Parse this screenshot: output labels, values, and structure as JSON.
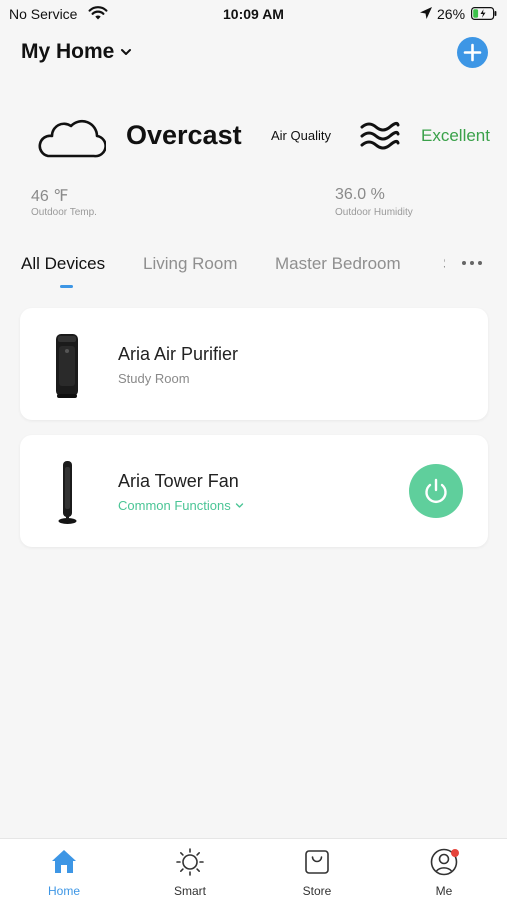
{
  "status_bar": {
    "carrier": "No Service",
    "time": "10:09 AM",
    "battery_percent": "26%",
    "battery_level": 0.26
  },
  "header": {
    "home_name": "My Home",
    "add_icon": "plus-icon"
  },
  "weather": {
    "condition": "Overcast",
    "condition_icon": "cloud-icon",
    "air_quality_label": "Air Quality",
    "air_quality_icon": "air-waves-icon",
    "air_quality_value": "Excellent",
    "air_quality_color": "#3aa14a",
    "temperature": {
      "value": "46 ℉",
      "label": "Outdoor Temp."
    },
    "humidity": {
      "value": "36.0 %",
      "label": "Outdoor Humidity"
    }
  },
  "tabs": [
    {
      "label": "All Devices",
      "active": true
    },
    {
      "label": "Living Room",
      "active": false
    },
    {
      "label": "Master Bedroom",
      "active": false
    },
    {
      "label": "S",
      "active": false
    }
  ],
  "devices": [
    {
      "name": "Aria Air Purifier",
      "subtitle": "Study Room",
      "icon": "air-purifier-image"
    },
    {
      "name": "Aria Tower Fan",
      "subtitle": "Common Functions",
      "icon": "tower-fan-image",
      "power_icon": "power-icon"
    }
  ],
  "bottom_nav": [
    {
      "label": "Home",
      "icon": "home-icon",
      "active": true
    },
    {
      "label": "Smart",
      "icon": "sun-icon",
      "active": false
    },
    {
      "label": "Store",
      "icon": "shopping-bag-icon",
      "active": false
    },
    {
      "label": "Me",
      "icon": "profile-icon",
      "active": false,
      "badge": true
    }
  ],
  "colors": {
    "accent": "#3d96e5",
    "power_green": "#5fcf9c",
    "function_green": "#4bc596",
    "badge_red": "#e5443b"
  }
}
